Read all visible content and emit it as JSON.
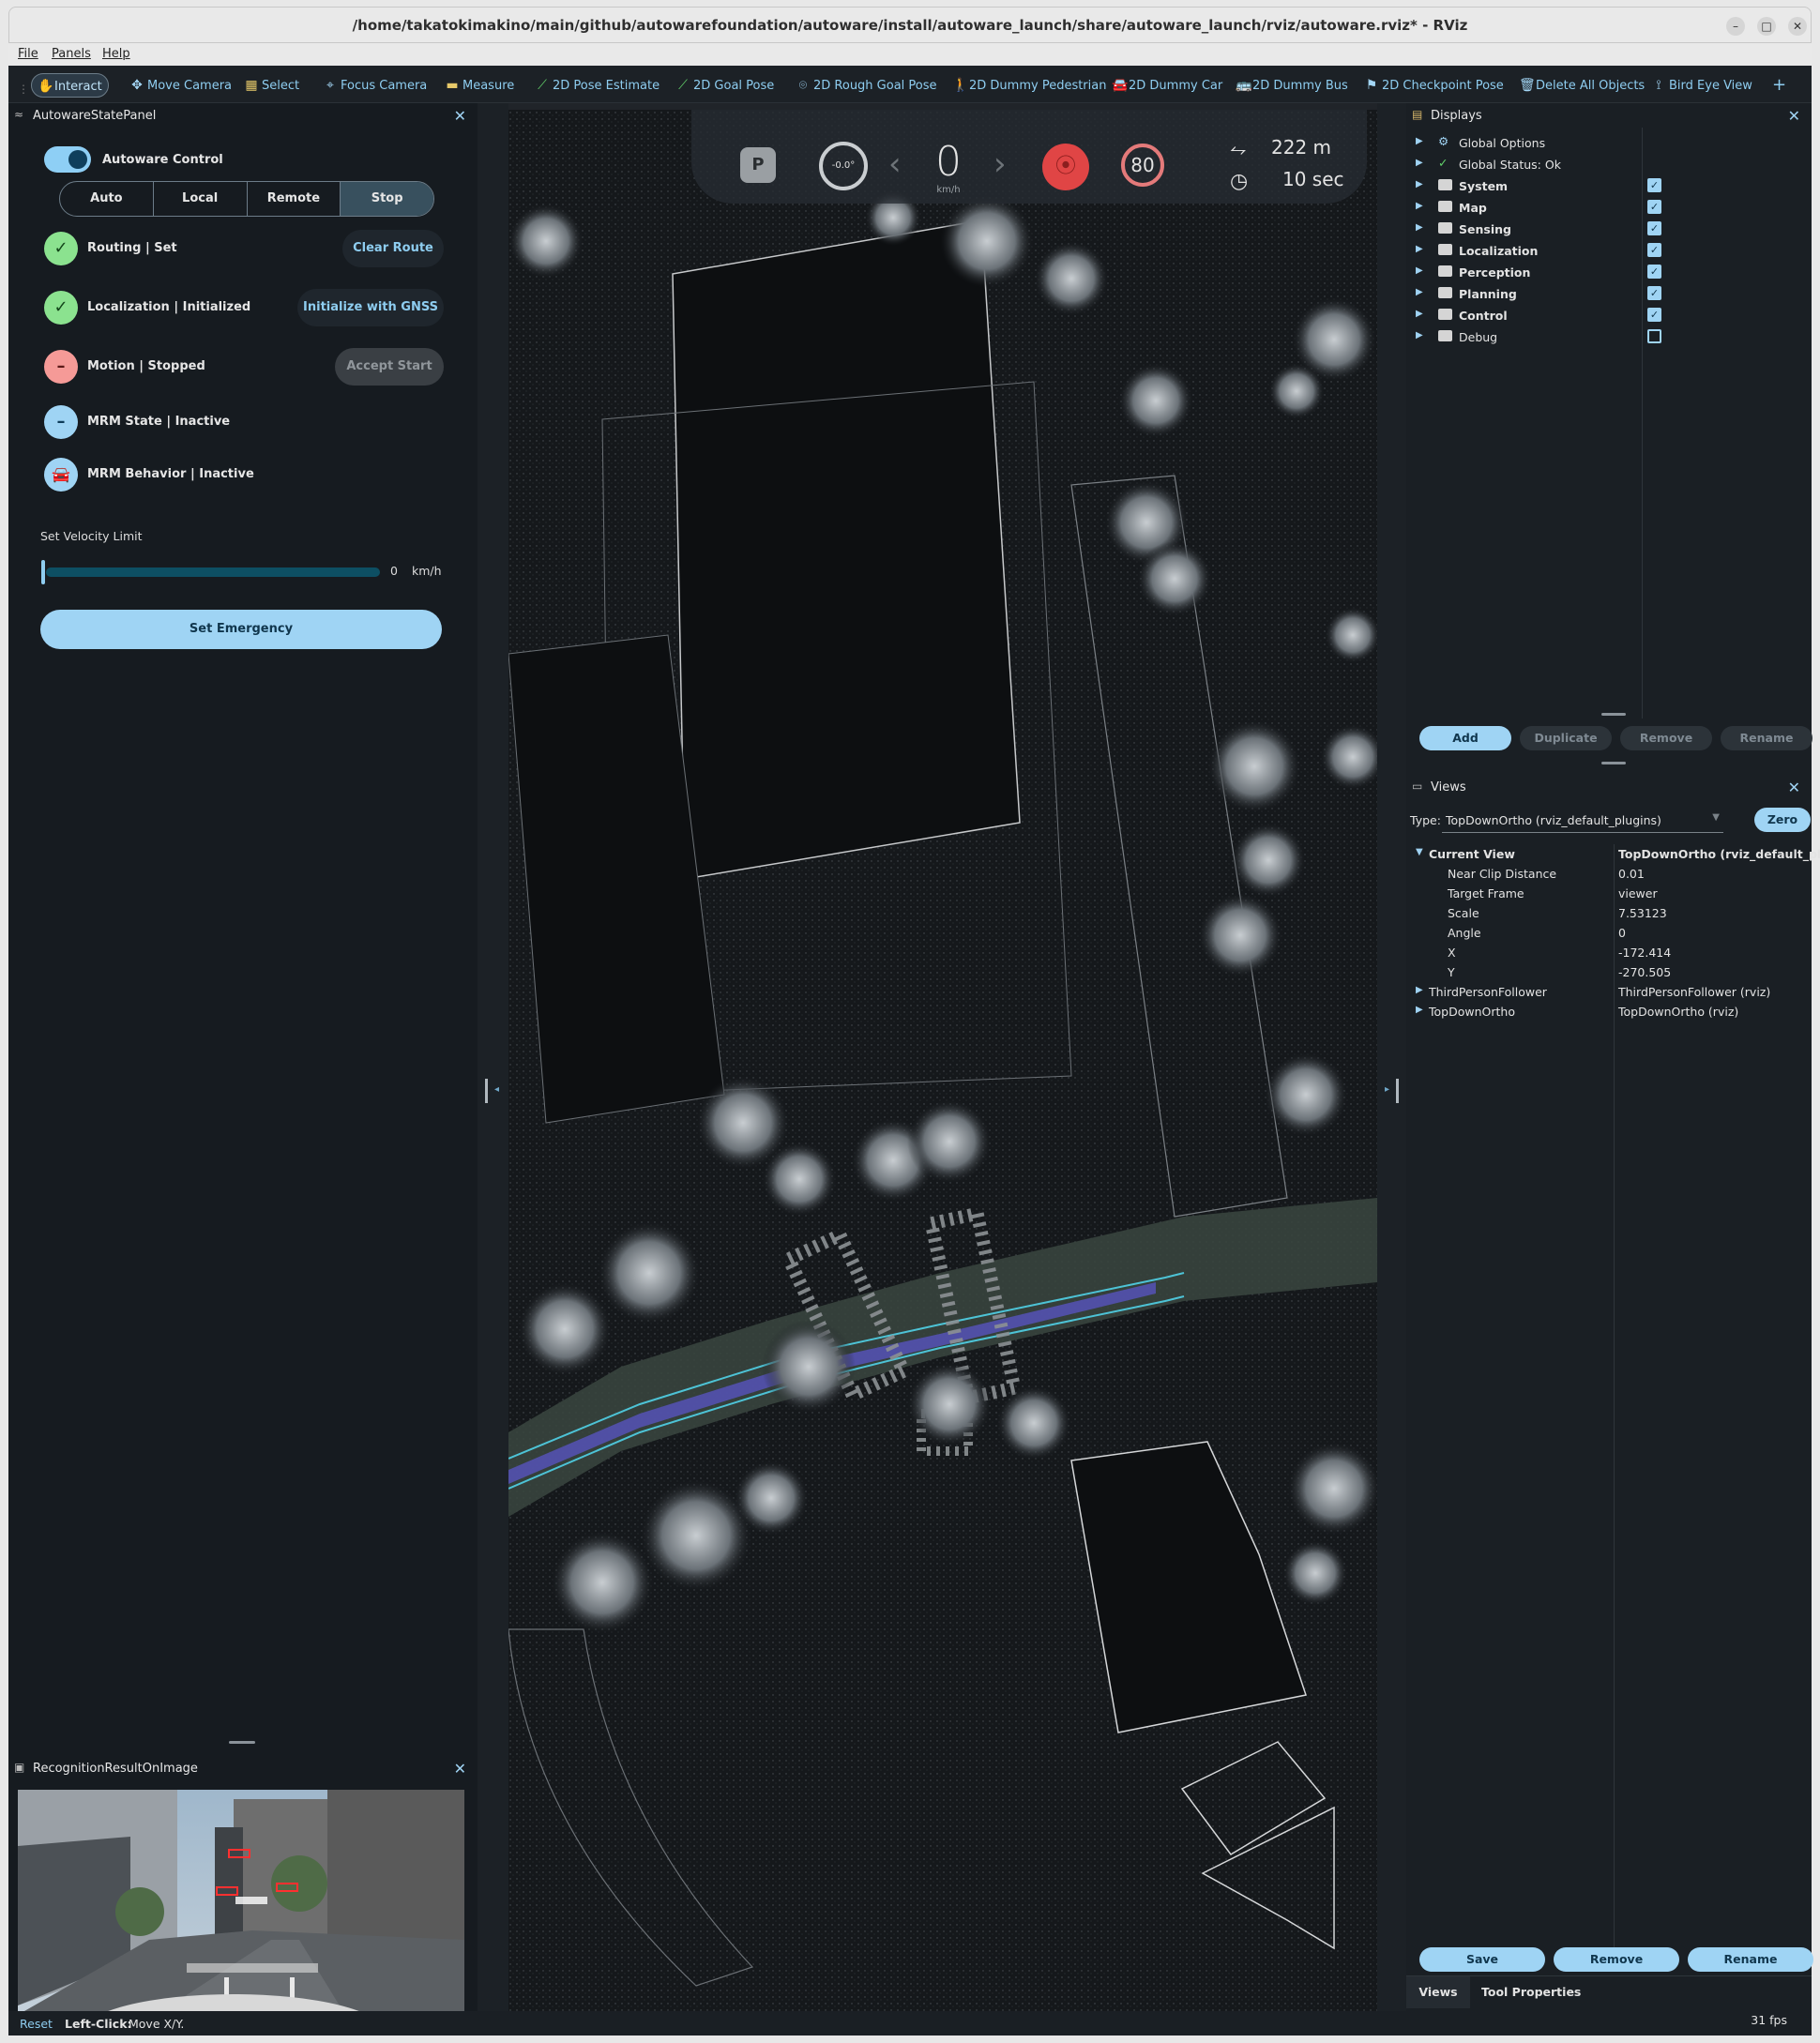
{
  "window": {
    "title": "/home/takatokimakino/main/github/autowarefoundation/autoware/install/autoware_launch/share/autoware_launch/rviz/autoware.rviz* - RViz"
  },
  "menu": [
    "File",
    "Panels",
    "Help"
  ],
  "toolbar": {
    "interact": "Interact",
    "move_camera": "Move Camera",
    "select": "Select",
    "focus_camera": "Focus Camera",
    "measure": "Measure",
    "pose_estimate": "2D Pose Estimate",
    "goal_pose": "2D Goal Pose",
    "rough_goal": "2D Rough Goal Pose",
    "dummy_pedestrian": "2D Dummy Pedestrian",
    "dummy_car": "2D Dummy Car",
    "dummy_bus": "2D Dummy Bus",
    "checkpoint": "2D Checkpoint Pose",
    "delete_all": "Delete All Objects",
    "bird_eye": "Bird Eye View",
    "add": "+"
  },
  "state_panel": {
    "title": "AutowareStatePanel",
    "autoware_control": "Autoware Control",
    "modes": [
      "Auto",
      "Local",
      "Remote",
      "Stop"
    ],
    "routing": "Routing | Set",
    "clear_route": "Clear Route",
    "localization": "Localization | Initialized",
    "init_gnss": "Initialize with GNSS",
    "motion": "Motion | Stopped",
    "accept_start": "Accept Start",
    "mrm_state": "MRM State | Inactive",
    "mrm_behavior": "MRM Behavior | Inactive",
    "velocity_label": "Set Velocity Limit",
    "velocity_value": "0",
    "velocity_unit": "km/h",
    "velocity_fraction": 0.0,
    "set_emergency": "Set Emergency"
  },
  "recognition_panel": {
    "title": "RecognitionResultOnImage"
  },
  "hud": {
    "gear": "P",
    "steering": "-0.0°",
    "speed": "0",
    "speed_unit": "km/h",
    "speed_limit": "80",
    "distance": "222 m",
    "time": "10 sec"
  },
  "displays": {
    "title": "Displays",
    "items": [
      {
        "label": "Global Options",
        "kind": "gear",
        "checked": null
      },
      {
        "label": "Global Status: Ok",
        "kind": "check",
        "checked": null
      },
      {
        "label": "System",
        "kind": "folder",
        "checked": true
      },
      {
        "label": "Map",
        "kind": "folder",
        "checked": true
      },
      {
        "label": "Sensing",
        "kind": "folder",
        "checked": true
      },
      {
        "label": "Localization",
        "kind": "folder",
        "checked": true
      },
      {
        "label": "Perception",
        "kind": "folder",
        "checked": true
      },
      {
        "label": "Planning",
        "kind": "folder",
        "checked": true
      },
      {
        "label": "Control",
        "kind": "folder",
        "checked": true
      },
      {
        "label": "Debug",
        "kind": "folder",
        "checked": false
      }
    ],
    "buttons": [
      "Add",
      "Duplicate",
      "Remove",
      "Rename"
    ]
  },
  "views": {
    "title": "Views",
    "type_label": "Type:",
    "type_value": "TopDownOrtho (rviz_default_plugins)",
    "zero": "Zero",
    "current_view": "Current View",
    "current_view_value": "TopDownOrtho (rviz_default_plug...",
    "props": [
      {
        "name": "Near Clip Distance",
        "value": "0.01"
      },
      {
        "name": "Target Frame",
        "value": "viewer"
      },
      {
        "name": "Scale",
        "value": "7.53123"
      },
      {
        "name": "Angle",
        "value": "0"
      },
      {
        "name": "X",
        "value": "-172.414"
      },
      {
        "name": "Y",
        "value": "-270.505"
      }
    ],
    "saved": [
      {
        "name": "ThirdPersonFollower",
        "value": "ThirdPersonFollower (rviz)"
      },
      {
        "name": "TopDownOrtho",
        "value": "TopDownOrtho (rviz)"
      }
    ],
    "buttons": [
      "Save",
      "Remove",
      "Rename"
    ],
    "tabs": [
      "Views",
      "Tool Properties"
    ]
  },
  "statusbar": {
    "reset": "Reset",
    "hint_key": "Left-Click:",
    "hint_text": "Move X/Y.",
    "fps": "31 fps"
  }
}
